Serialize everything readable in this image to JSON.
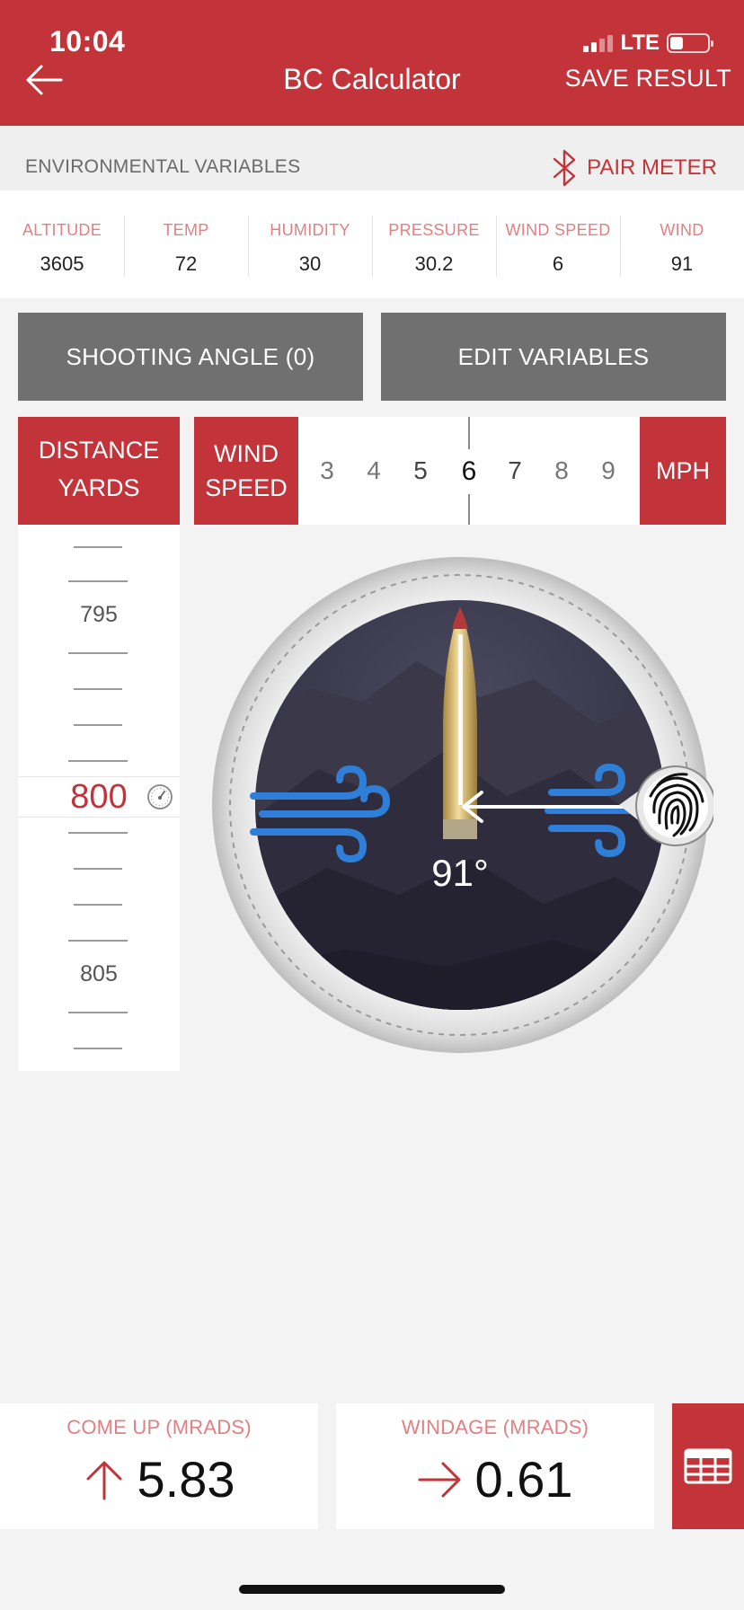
{
  "status": {
    "time": "10:04",
    "network": "LTE"
  },
  "header": {
    "title": "BC Calculator",
    "save_label": "SAVE RESULT"
  },
  "env": {
    "label": "ENVIRONMENTAL VARIABLES",
    "pair_label": "PAIR METER"
  },
  "variables": [
    {
      "label": "ALTITUDE",
      "value": "3605"
    },
    {
      "label": "TEMP",
      "value": "72"
    },
    {
      "label": "HUMIDITY",
      "value": "30"
    },
    {
      "label": "PRESSURE",
      "value": "30.2"
    },
    {
      "label": "WIND SPEED",
      "value": "6"
    },
    {
      "label": "WIND",
      "value": "91"
    }
  ],
  "buttons": {
    "angle": "SHOOTING ANGLE (0)",
    "edit": "EDIT VARIABLES"
  },
  "distance": {
    "header_line1": "DISTANCE",
    "header_line2": "YARDS",
    "label_above": "795",
    "selected": "800",
    "label_below": "805"
  },
  "wind_speed": {
    "header_line1": "WIND",
    "header_line2": "SPEED",
    "scale": [
      "3",
      "4",
      "5",
      "6",
      "7",
      "8",
      "9"
    ],
    "selected": "6",
    "unit": "MPH"
  },
  "dial": {
    "angle_text": "91°"
  },
  "results": {
    "come_up": {
      "label": "COME UP (MRADS)",
      "value": "5.83"
    },
    "windage": {
      "label": "WINDAGE (MRADS)",
      "value": "0.61"
    }
  },
  "icons": {
    "back": "back-arrow-icon",
    "bluetooth": "bluetooth-icon",
    "gauge": "gauge-icon",
    "wind": "wind-icon",
    "fingerprint": "fingerprint-icon",
    "up": "arrow-up-icon",
    "right": "arrow-right-icon",
    "table": "table-icon"
  },
  "colors": {
    "brand": "#c3343a",
    "gray_button": "#707070",
    "wind_icon": "#2f7fd8",
    "label_pink": "#e37f82"
  }
}
